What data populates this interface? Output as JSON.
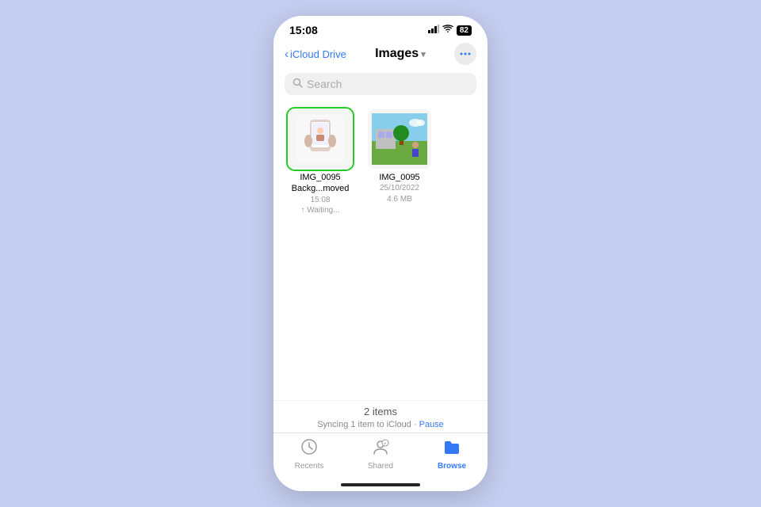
{
  "statusBar": {
    "time": "15:08",
    "batteryLevel": "82",
    "batteryIcon": "🔋",
    "wifiIcon": "wifi",
    "signalIcon": "signal"
  },
  "navBar": {
    "backLabel": "iCloud Drive",
    "title": "Images",
    "moreIcon": "•••"
  },
  "search": {
    "placeholder": "Search"
  },
  "files": [
    {
      "name": "IMG_0095",
      "subName": "Backg...moved",
      "meta1": "15:08",
      "meta2": "",
      "uploadStatus": "↑ Waiting...",
      "selected": true,
      "type": "phone"
    },
    {
      "name": "IMG_0095",
      "subName": "",
      "meta1": "25/10/2022",
      "meta2": "4.6 MB",
      "uploadStatus": "",
      "selected": false,
      "type": "outdoor"
    }
  ],
  "bottomBar": {
    "itemsCount": "2 items",
    "syncText": "Syncing 1 item to iCloud",
    "separator": " · ",
    "pauseLabel": "Pause"
  },
  "tabBar": {
    "tabs": [
      {
        "id": "recents",
        "label": "Recents",
        "icon": "🕐",
        "active": false
      },
      {
        "id": "shared",
        "label": "Shared",
        "icon": "👤",
        "active": false
      },
      {
        "id": "browse",
        "label": "Browse",
        "icon": "📁",
        "active": true
      }
    ]
  }
}
